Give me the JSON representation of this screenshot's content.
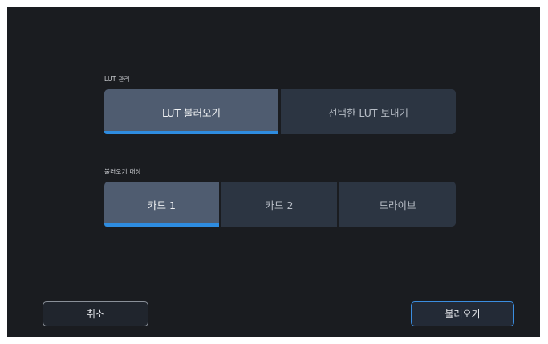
{
  "lut_management": {
    "label": "LUT 관리",
    "options": [
      {
        "label": "LUT 불러오기",
        "selected": true
      },
      {
        "label": "선택한 LUT 보내기",
        "selected": false
      }
    ]
  },
  "import_target": {
    "label": "불러오기 대상",
    "options": [
      {
        "label": "카드 1",
        "selected": true
      },
      {
        "label": "카드 2",
        "selected": false
      },
      {
        "label": "드라이브",
        "selected": false
      }
    ]
  },
  "footer": {
    "cancel_label": "취소",
    "confirm_label": "불러오기"
  },
  "colors": {
    "background": "#1a1c20",
    "segment": "#2c3542",
    "segment_selected": "#4f5c70",
    "accent": "#2e8ce0"
  }
}
